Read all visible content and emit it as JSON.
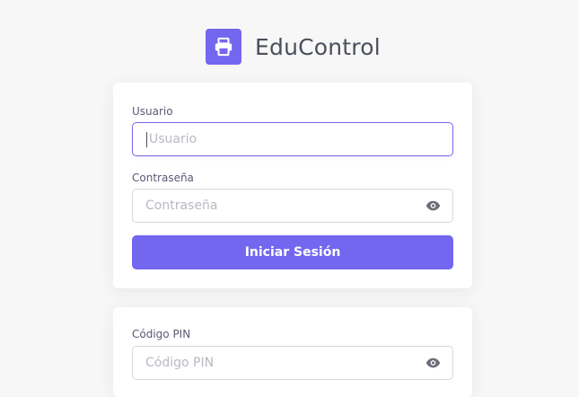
{
  "brand": {
    "name": "EduControl",
    "logo_icon": "printer-icon",
    "accent_color": "#7367f0"
  },
  "login_form": {
    "username": {
      "label": "Usuario",
      "placeholder": "Usuario",
      "value": ""
    },
    "password": {
      "label": "Contraseña",
      "placeholder": "Contraseña",
      "value": "",
      "toggle_icon": "eye-icon"
    },
    "submit_label": "Iniciar Sesión"
  },
  "pin_form": {
    "pin": {
      "label": "Código PIN",
      "placeholder": "Código PIN",
      "value": "",
      "toggle_icon": "eye-icon"
    }
  }
}
